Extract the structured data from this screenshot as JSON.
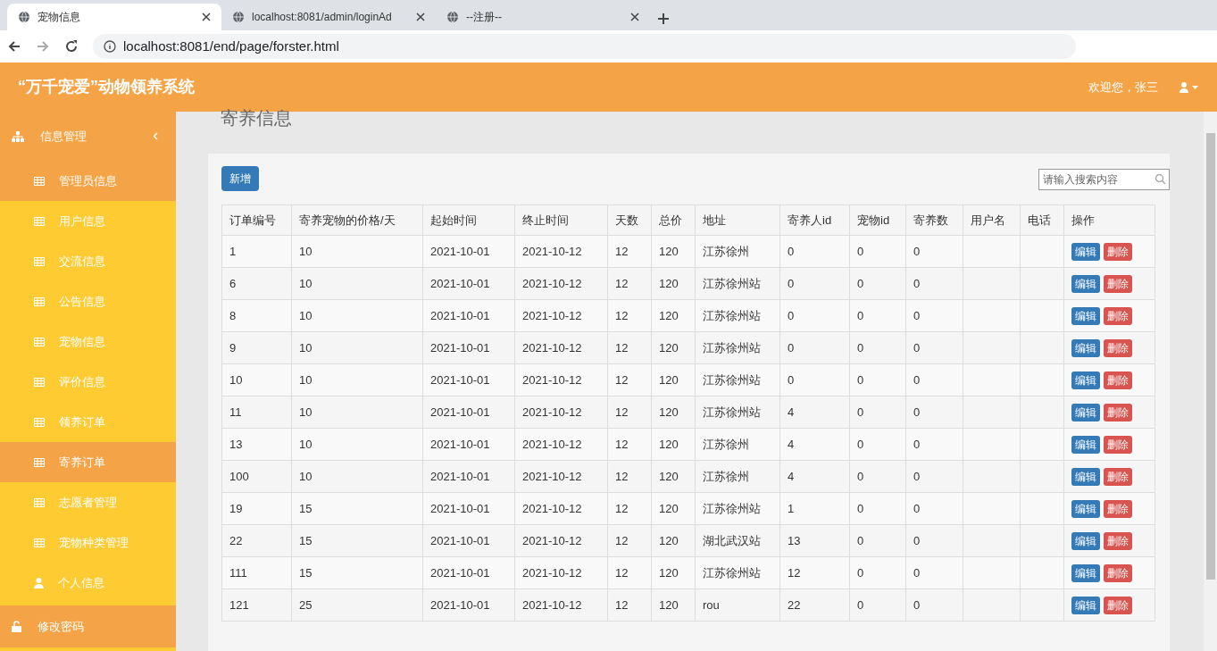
{
  "browser": {
    "tabs": [
      {
        "title": "宠物信息",
        "selected": true
      },
      {
        "title": "localhost:8081/admin/loginAd",
        "selected": false
      },
      {
        "title": "--注册--",
        "selected": false
      }
    ],
    "url": "localhost:8081/end/page/forster.html"
  },
  "app": {
    "title": "“万千宠爱”动物领养系统",
    "welcome": "欢迎您，张三"
  },
  "sidebar": {
    "items": [
      {
        "label": "信息管理",
        "kind": "group",
        "expanded": true,
        "children": [
          {
            "label": "管理员信息",
            "kind": "table",
            "highlighted": true
          },
          {
            "label": "用户信息",
            "kind": "table",
            "highlighted": false
          },
          {
            "label": "交流信息",
            "kind": "table",
            "highlighted": false
          },
          {
            "label": "公告信息",
            "kind": "table",
            "highlighted": false
          },
          {
            "label": "宠物信息",
            "kind": "table",
            "highlighted": false
          },
          {
            "label": "评价信息",
            "kind": "table",
            "highlighted": false
          },
          {
            "label": "领养订单",
            "kind": "table",
            "highlighted": false
          },
          {
            "label": "寄养订单",
            "kind": "table",
            "highlighted": true
          },
          {
            "label": "志愿者管理",
            "kind": "table",
            "highlighted": false
          },
          {
            "label": "宠物种类管理",
            "kind": "table",
            "highlighted": false
          },
          {
            "label": "个人信息",
            "kind": "user",
            "highlighted": false
          }
        ]
      },
      {
        "label": "修改密码",
        "kind": "lock"
      }
    ]
  },
  "page": {
    "title": "寄养信息",
    "add_button": "新增",
    "search": {
      "placeholder": "请输入搜索内容"
    },
    "table": {
      "columns": [
        "订单编号",
        "寄养宠物的价格/天",
        "起始时间",
        "终止时间",
        "天数",
        "总价",
        "地址",
        "寄养人id",
        "宠物id",
        "寄养数",
        "用户名",
        "电话",
        "操作"
      ],
      "rows": [
        {
          "cells": [
            "1",
            "10",
            "2021-10-01",
            "2021-10-12",
            "12",
            "120",
            "江苏徐州",
            "0",
            "0",
            "0",
            "",
            ""
          ],
          "actions": [
            "编辑",
            "删除"
          ]
        },
        {
          "cells": [
            "6",
            "10",
            "2021-10-01",
            "2021-10-12",
            "12",
            "120",
            "江苏徐州站",
            "0",
            "0",
            "0",
            "",
            ""
          ],
          "actions": [
            "编辑",
            "删除"
          ]
        },
        {
          "cells": [
            "8",
            "10",
            "2021-10-01",
            "2021-10-12",
            "12",
            "120",
            "江苏徐州站",
            "0",
            "0",
            "0",
            "",
            ""
          ],
          "actions": [
            "编辑",
            "删除"
          ]
        },
        {
          "cells": [
            "9",
            "10",
            "2021-10-01",
            "2021-10-12",
            "12",
            "120",
            "江苏徐州站",
            "0",
            "0",
            "0",
            "",
            ""
          ],
          "actions": [
            "编辑",
            "删除"
          ]
        },
        {
          "cells": [
            "10",
            "10",
            "2021-10-01",
            "2021-10-12",
            "12",
            "120",
            "江苏徐州站",
            "0",
            "0",
            "0",
            "",
            ""
          ],
          "actions": [
            "编辑",
            "删除"
          ]
        },
        {
          "cells": [
            "11",
            "10",
            "2021-10-01",
            "2021-10-12",
            "12",
            "120",
            "江苏徐州站",
            "4",
            "0",
            "0",
            "",
            ""
          ],
          "actions": [
            "编辑",
            "删除"
          ]
        },
        {
          "cells": [
            "13",
            "10",
            "2021-10-01",
            "2021-10-12",
            "12",
            "120",
            "江苏徐州",
            "4",
            "0",
            "0",
            "",
            ""
          ],
          "actions": [
            "编辑",
            "删除"
          ]
        },
        {
          "cells": [
            "100",
            "10",
            "2021-10-01",
            "2021-10-12",
            "12",
            "120",
            "江苏徐州",
            "4",
            "0",
            "0",
            "",
            ""
          ],
          "actions": [
            "编辑",
            "删除"
          ]
        },
        {
          "cells": [
            "19",
            "15",
            "2021-10-01",
            "2021-10-12",
            "12",
            "120",
            "江苏徐州站",
            "1",
            "0",
            "0",
            "",
            ""
          ],
          "actions": [
            "编辑",
            "删除"
          ]
        },
        {
          "cells": [
            "22",
            "15",
            "2021-10-01",
            "2021-10-12",
            "12",
            "120",
            "湖北武汉站",
            "13",
            "0",
            "0",
            "",
            ""
          ],
          "actions": [
            "编辑",
            "删除"
          ]
        },
        {
          "cells": [
            "111",
            "15",
            "2021-10-01",
            "2021-10-12",
            "12",
            "120",
            "江苏徐州站",
            "12",
            "0",
            "0",
            "",
            ""
          ],
          "actions": [
            "编辑",
            "删除"
          ]
        },
        {
          "cells": [
            "121",
            "25",
            "2021-10-01",
            "2021-10-12",
            "12",
            "120",
            "rou",
            "22",
            "0",
            "0",
            "",
            ""
          ],
          "actions": [
            "编辑",
            "删除"
          ]
        }
      ]
    }
  }
}
